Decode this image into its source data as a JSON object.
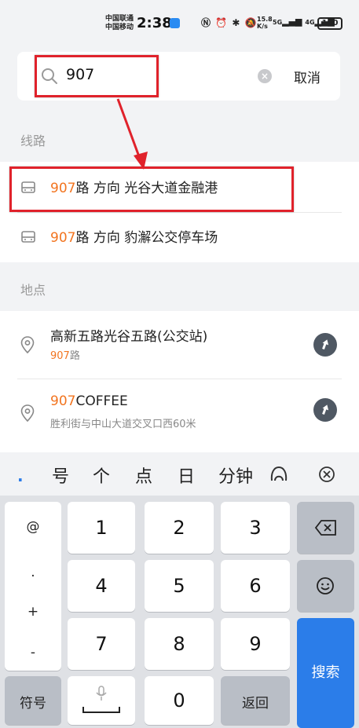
{
  "status_bar": {
    "carrier_1": "中国联通",
    "carrier_2": "中国移动",
    "time": "2:38",
    "speed_top": "15.8",
    "speed_bottom": "K/s",
    "net_1": "5G",
    "net_2": "4G",
    "battery": "100"
  },
  "search": {
    "value": "907",
    "cancel_label": "取消"
  },
  "routes_section": {
    "title": "线路",
    "items": [
      {
        "number": "907",
        "suffix": "路 方向 光谷大道金融港"
      },
      {
        "number": "907",
        "suffix": "路 方向 豹澥公交停车场"
      }
    ]
  },
  "places_section": {
    "title": "地点",
    "items": [
      {
        "title_prefix": "",
        "title_highlight": "",
        "title_rest": "高新五路光谷五路(公交站)",
        "sub_highlight": "907",
        "sub_rest": "路"
      },
      {
        "title_prefix": "",
        "title_highlight": "907",
        "title_rest": "COFFEE",
        "sub_highlight": "",
        "sub_rest": "胜利街与中山大道交叉口西60米"
      }
    ]
  },
  "candidates": {
    "dot": ".",
    "items": [
      "号",
      "个",
      "点",
      "日",
      "分钟"
    ]
  },
  "keyboard": {
    "symbols": [
      "@",
      ".",
      "+",
      "-"
    ],
    "digits": [
      "1",
      "2",
      "3",
      "4",
      "5",
      "6",
      "7",
      "8",
      "9",
      "0"
    ],
    "symbol_key": "符号",
    "back_key": "返回",
    "search_key": "搜索"
  },
  "colors": {
    "highlight": "#f2741f",
    "accent_blue": "#2b7de9",
    "annotation_red": "#e0222b"
  }
}
